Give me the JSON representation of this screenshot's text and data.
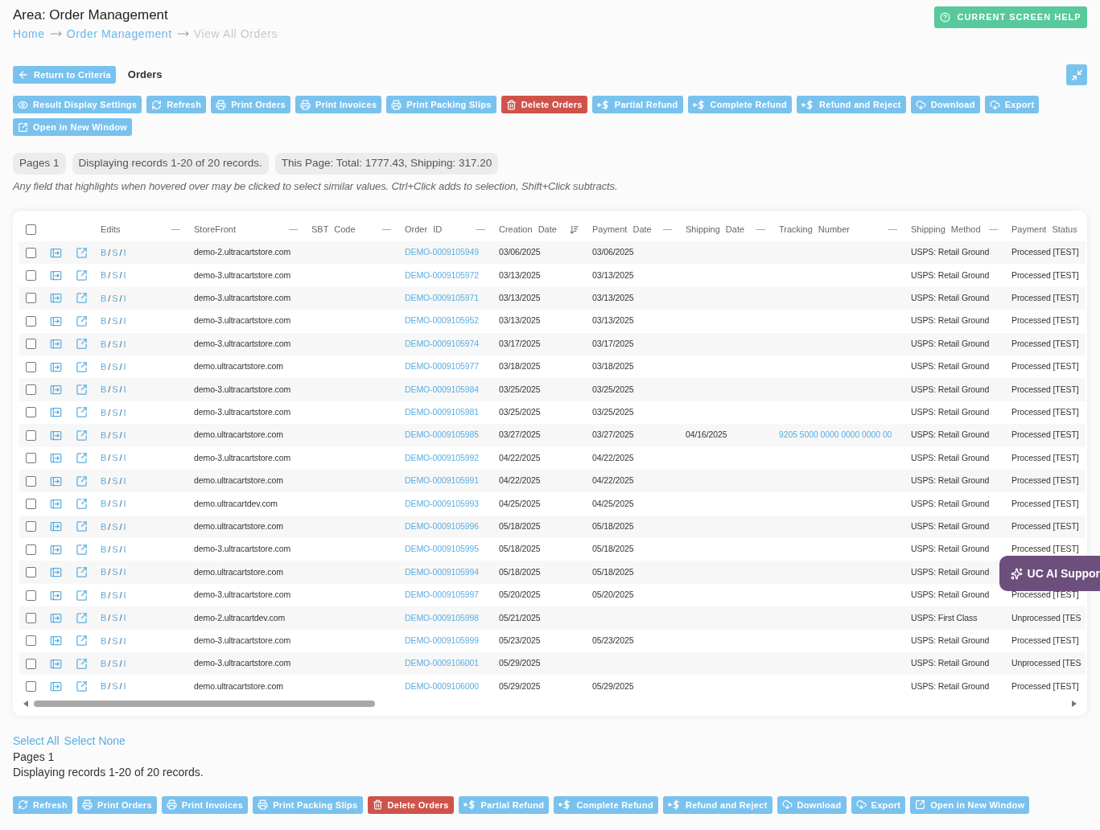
{
  "header": {
    "title": "Area: Order Management",
    "help_button": "CURRENT SCREEN HELP"
  },
  "breadcrumb": [
    {
      "label": "Home",
      "current": false
    },
    {
      "label": "Order Management",
      "current": false
    },
    {
      "label": "View All Orders",
      "current": true
    }
  ],
  "return_button": "Return to Criteria",
  "section_title": "Orders",
  "toolbar": [
    {
      "label": "Result Display Settings",
      "kind": "settings"
    },
    {
      "label": "Refresh",
      "kind": "refresh"
    },
    {
      "label": "Print Orders",
      "kind": "print"
    },
    {
      "label": "Print Invoices",
      "kind": "print"
    },
    {
      "label": "Print Packing Slips",
      "kind": "print"
    },
    {
      "label": "Delete Orders",
      "kind": "delete"
    },
    {
      "label": "Partial Refund",
      "kind": "refund"
    },
    {
      "label": "Complete Refund",
      "kind": "refund"
    },
    {
      "label": "Refund and Reject",
      "kind": "refund"
    },
    {
      "label": "Download",
      "kind": "download"
    },
    {
      "label": "Export",
      "kind": "download"
    },
    {
      "label": "Open in New Window",
      "kind": "window"
    }
  ],
  "summary": [
    "Pages 1",
    "Displaying records 1-20 of 20 records.",
    "This Page: Total: 1777.43, Shipping: 317.20"
  ],
  "hint": "Any field that highlights when hovered over may be clicked to select similar values. Ctrl+Click adds to selection, Shift+Click subtracts.",
  "table": {
    "all_checked": false,
    "columns": [
      {
        "label": "Edits",
        "handle": true,
        "sorted": false
      },
      {
        "label": "StoreFront",
        "handle": true,
        "sorted": false
      },
      {
        "label": "SBT Code",
        "handle": true,
        "sorted": false
      },
      {
        "label": "Order ID",
        "handle": true,
        "sorted": false
      },
      {
        "label": "Creation Date",
        "handle": false,
        "sorted": true
      },
      {
        "label": "Payment Date",
        "handle": true,
        "sorted": false
      },
      {
        "label": "Shipping Date",
        "handle": true,
        "sorted": false
      },
      {
        "label": "Tracking Number",
        "handle": true,
        "sorted": false
      },
      {
        "label": "Shipping Method",
        "handle": true,
        "sorted": false
      },
      {
        "label": "Payment Status",
        "handle": false,
        "sorted": false
      }
    ],
    "rows": [
      {
        "checked": false,
        "edits": [
          "B",
          "/",
          "S",
          "/",
          "I"
        ],
        "storefront": "demo-2.ultracartstore.com",
        "order_id": "DEMO-0009105949",
        "creation_date": "03/06/2025",
        "payment_date": "03/06/2025",
        "shipping_method": "USPS: Retail Ground",
        "payment_status": "Processed [TEST]"
      },
      {
        "checked": false,
        "edits": [
          "B",
          "/",
          "S",
          "/",
          "I"
        ],
        "storefront": "demo-3.ultracartstore.com",
        "order_id": "DEMO-0009105972",
        "creation_date": "03/13/2025",
        "payment_date": "03/13/2025",
        "shipping_method": "USPS: Retail Ground",
        "payment_status": "Processed [TEST]"
      },
      {
        "checked": false,
        "edits": [
          "B",
          "/",
          "S",
          "/",
          "I"
        ],
        "storefront": "demo-3.ultracartstore.com",
        "order_id": "DEMO-0009105971",
        "creation_date": "03/13/2025",
        "payment_date": "03/13/2025",
        "shipping_method": "USPS: Retail Ground",
        "payment_status": "Processed [TEST]"
      },
      {
        "checked": false,
        "edits": [
          "B",
          "/",
          "S",
          "/",
          "I"
        ],
        "storefront": "demo-3.ultracartstore.com",
        "order_id": "DEMO-0009105952",
        "creation_date": "03/13/2025",
        "payment_date": "03/13/2025",
        "shipping_method": "USPS: Retail Ground",
        "payment_status": "Processed [TEST]"
      },
      {
        "checked": false,
        "edits": [
          "B",
          "/",
          "S",
          "/",
          "I"
        ],
        "storefront": "demo-3.ultracartstore.com",
        "order_id": "DEMO-0009105974",
        "creation_date": "03/17/2025",
        "payment_date": "03/17/2025",
        "shipping_method": "USPS: Retail Ground",
        "payment_status": "Processed [TEST]"
      },
      {
        "checked": false,
        "edits": [
          "B",
          "/",
          "S",
          "/",
          "I"
        ],
        "storefront": "demo.ultracartstore.com",
        "order_id": "DEMO-0009105977",
        "creation_date": "03/18/2025",
        "payment_date": "03/18/2025",
        "shipping_method": "USPS: Retail Ground",
        "payment_status": "Processed [TEST]"
      },
      {
        "checked": false,
        "edits": [
          "B",
          "/",
          "S",
          "/",
          "I"
        ],
        "storefront": "demo-3.ultracartstore.com",
        "order_id": "DEMO-0009105984",
        "creation_date": "03/25/2025",
        "payment_date": "03/25/2025",
        "shipping_method": "USPS: Retail Ground",
        "payment_status": "Processed [TEST]"
      },
      {
        "checked": false,
        "edits": [
          "B",
          "/",
          "S",
          "/",
          "I"
        ],
        "storefront": "demo-3.ultracartstore.com",
        "order_id": "DEMO-0009105981",
        "creation_date": "03/25/2025",
        "payment_date": "03/25/2025",
        "shipping_method": "USPS: Retail Ground",
        "payment_status": "Processed [TEST]"
      },
      {
        "checked": false,
        "edits": [
          "B",
          "/",
          "S",
          "/",
          "I"
        ],
        "storefront": "demo.ultracartstore.com",
        "order_id": "DEMO-0009105985",
        "creation_date": "03/27/2025",
        "payment_date": "03/27/2025",
        "shipping_date": "04/16/2025",
        "tracking_number": "9205 5000 0000 0000 0000 00",
        "shipping_method": "USPS: Retail Ground",
        "payment_status": "Processed [TEST]"
      },
      {
        "checked": false,
        "edits": [
          "B",
          "/",
          "S",
          "/",
          "I"
        ],
        "storefront": "demo-3.ultracartstore.com",
        "order_id": "DEMO-0009105992",
        "creation_date": "04/22/2025",
        "payment_date": "04/22/2025",
        "shipping_method": "USPS: Retail Ground",
        "payment_status": "Processed [TEST]"
      },
      {
        "checked": false,
        "edits": [
          "B",
          "/",
          "S",
          "/",
          "I"
        ],
        "storefront": "demo.ultracartstore.com",
        "order_id": "DEMO-0009105991",
        "creation_date": "04/22/2025",
        "payment_date": "04/22/2025",
        "shipping_method": "USPS: Retail Ground",
        "payment_status": "Processed [TEST]"
      },
      {
        "checked": false,
        "edits": [
          "B",
          "/",
          "S",
          "/",
          "I"
        ],
        "storefront": "demo.ultracartdev.com",
        "order_id": "DEMO-0009105993",
        "creation_date": "04/25/2025",
        "payment_date": "04/25/2025",
        "shipping_method": "USPS: Retail Ground",
        "payment_status": "Processed [TEST]"
      },
      {
        "checked": false,
        "edits": [
          "B",
          "/",
          "S",
          "/",
          "I"
        ],
        "storefront": "demo.ultracartstore.com",
        "order_id": "DEMO-0009105996",
        "creation_date": "05/18/2025",
        "payment_date": "05/18/2025",
        "shipping_method": "USPS: Retail Ground",
        "payment_status": "Processed [TEST]"
      },
      {
        "checked": false,
        "edits": [
          "B",
          "/",
          "S",
          "/",
          "I"
        ],
        "storefront": "demo-3.ultracartstore.com",
        "order_id": "DEMO-0009105995",
        "creation_date": "05/18/2025",
        "payment_date": "05/18/2025",
        "shipping_method": "USPS: Retail Ground",
        "payment_status": "Processed [TEST]"
      },
      {
        "checked": false,
        "edits": [
          "B",
          "/",
          "S",
          "/",
          "I"
        ],
        "storefront": "demo.ultracartstore.com",
        "order_id": "DEMO-0009105994",
        "creation_date": "05/18/2025",
        "payment_date": "05/18/2025",
        "shipping_method": "USPS: Retail Ground"
      },
      {
        "checked": false,
        "edits": [
          "B",
          "/",
          "S",
          "/",
          "I"
        ],
        "storefront": "demo-3.ultracartstore.com",
        "order_id": "DEMO-0009105997",
        "creation_date": "05/20/2025",
        "payment_date": "05/20/2025",
        "shipping_method": "USPS: Retail Ground",
        "payment_status": "Processed [TEST]"
      },
      {
        "checked": false,
        "edits": [
          "B",
          "/",
          "S",
          "/",
          "I"
        ],
        "storefront": "demo-2.ultracartdev.com",
        "order_id": "DEMO-0009105998",
        "creation_date": "05/21/2025",
        "shipping_method": "USPS: First Class",
        "payment_status": "Unprocessed [TES"
      },
      {
        "checked": false,
        "edits": [
          "B",
          "/",
          "S",
          "/",
          "I"
        ],
        "storefront": "demo-3.ultracartstore.com",
        "order_id": "DEMO-0009105999",
        "creation_date": "05/23/2025",
        "payment_date": "05/23/2025",
        "shipping_method": "USPS: Retail Ground",
        "payment_status": "Processed [TEST]"
      },
      {
        "checked": false,
        "edits": [
          "B",
          "/",
          "S",
          "/",
          "I"
        ],
        "storefront": "demo-3.ultracartstore.com",
        "order_id": "DEMO-0009106001",
        "creation_date": "05/29/2025",
        "shipping_method": "USPS: Retail Ground",
        "payment_status": "Unprocessed [TES"
      },
      {
        "checked": false,
        "edits": [
          "B",
          "/",
          "S",
          "/",
          "I"
        ],
        "storefront": "demo.ultracartstore.com",
        "order_id": "DEMO-0009106000",
        "creation_date": "05/29/2025",
        "payment_date": "05/29/2025",
        "shipping_method": "USPS: Retail Ground",
        "payment_status": "Processed [TEST]"
      }
    ]
  },
  "footer": {
    "links": [
      "Select All",
      "Select None"
    ],
    "pages": "Pages 1",
    "records": "Displaying records 1-20 of 20 records."
  },
  "bottom_toolbar": [
    {
      "label": "Refresh",
      "kind": "refresh"
    },
    {
      "label": "Print Orders",
      "kind": "print"
    },
    {
      "label": "Print Invoices",
      "kind": "print"
    },
    {
      "label": "Print Packing Slips",
      "kind": "print"
    },
    {
      "label": "Delete Orders",
      "kind": "delete"
    },
    {
      "label": "Partial Refund",
      "kind": "refund"
    },
    {
      "label": "Complete Refund",
      "kind": "refund"
    },
    {
      "label": "Refund and Reject",
      "kind": "refund"
    },
    {
      "label": "Download",
      "kind": "download"
    },
    {
      "label": "Export",
      "kind": "download"
    },
    {
      "label": "Open in New Window",
      "kind": "window"
    }
  ],
  "ai_button": "UC AI Suppor"
}
